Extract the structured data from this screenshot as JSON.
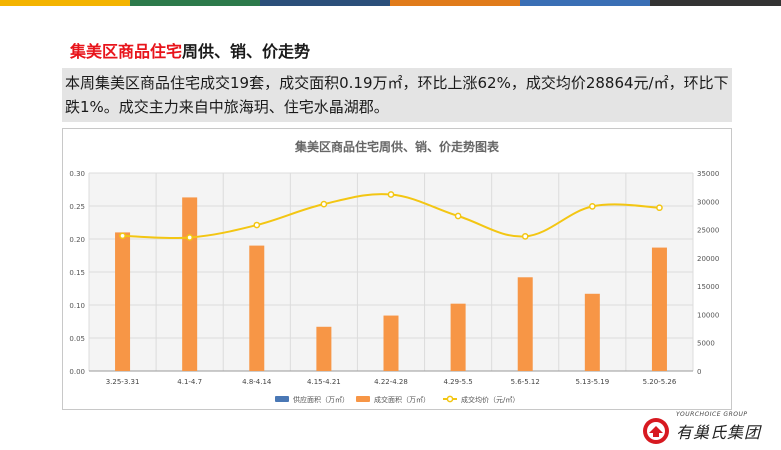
{
  "top_bar_colors": [
    "#f4b400",
    "#2c7a4b",
    "#2b4f7a",
    "#e07b1a",
    "#3a6fb5",
    "#333333"
  ],
  "heading": {
    "highlight": "集美区商品住宅",
    "rest": "周供、销、价走势"
  },
  "summary": "本周集美区商品住宅成交19套，成交面积0.19万㎡，环比上涨62%，成交均价28864元/㎡，环比下跌1%。成交主力来自中旅海玥、住宅水晶湖郡。",
  "logo": {
    "english": "YOURCHOICE GROUP",
    "chinese": "有巢氏集团"
  },
  "chart_data": {
    "type": "bar",
    "title": "集美区商品住宅周供、销、价走势图表",
    "categories": [
      "3.25-3.31",
      "4.1-4.7",
      "4.8-4.14",
      "4.15-4.21",
      "4.22-4.28",
      "4.29-5.5",
      "5.6-5.12",
      "5.13-5.19",
      "5.20-5.26"
    ],
    "y_left": {
      "min": 0,
      "max": 0.3,
      "ticks": [
        "0.00",
        "0.05",
        "0.10",
        "0.15",
        "0.20",
        "0.25",
        "0.30"
      ]
    },
    "y_right": {
      "min": 0,
      "max": 35000,
      "ticks": [
        "0",
        "5000",
        "10000",
        "15000",
        "20000",
        "25000",
        "30000",
        "35000"
      ]
    },
    "grid": true,
    "legend_position": "bottom",
    "series": [
      {
        "name": "供应面积（万㎡）",
        "type": "bar",
        "axis": "left",
        "color": "#4a78b5",
        "values": [
          0,
          0,
          0,
          0,
          0,
          0,
          0,
          0,
          0
        ]
      },
      {
        "name": "成交面积（万㎡）",
        "type": "bar",
        "axis": "left",
        "color": "#f79646",
        "values": [
          0.21,
          0.263,
          0.19,
          0.067,
          0.084,
          0.102,
          0.142,
          0.117,
          0.187
        ]
      },
      {
        "name": "成交均价（元/㎡）",
        "type": "line",
        "axis": "right",
        "color": "#f3c613",
        "values": [
          23900,
          23600,
          25800,
          29500,
          31200,
          27400,
          23800,
          29100,
          28864
        ]
      }
    ]
  }
}
